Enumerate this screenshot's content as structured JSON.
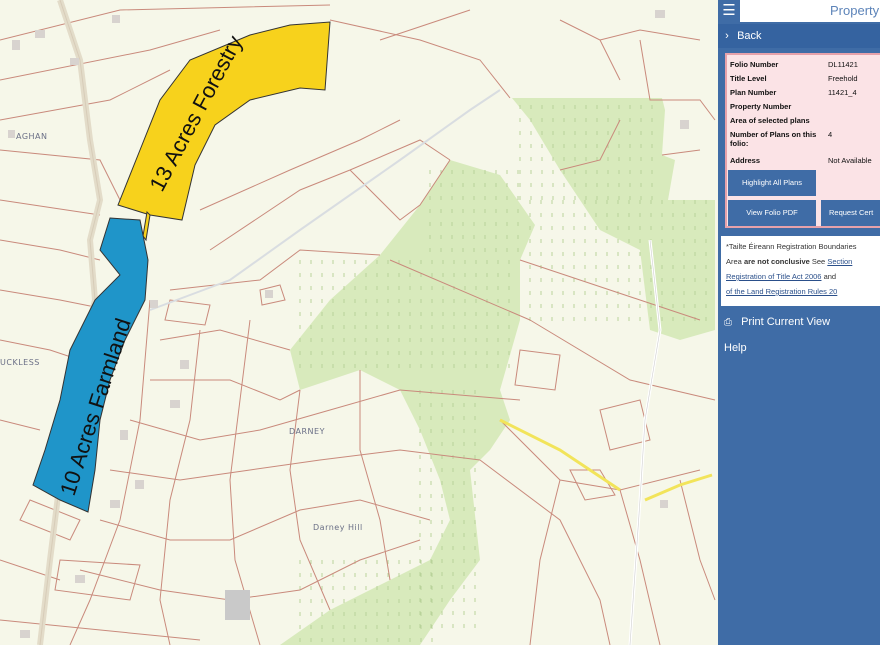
{
  "map": {
    "parcels": [
      {
        "label": "13 Acres Forestry",
        "color": "#f7d21c"
      },
      {
        "label": "10 Acres Farmland",
        "color": "#1f95c9"
      }
    ],
    "places": [
      "AGHAN",
      "UCKLESS",
      "DARNEY",
      "Darney Hill"
    ],
    "colors": {
      "base": "#f6f7e9",
      "forest": "#d8eabc",
      "boundary": "#c98a7c",
      "road": "#f2e45a"
    }
  },
  "panel": {
    "menu_icon": "hamburger-icon",
    "title": "Property",
    "back_label": "Back",
    "info": {
      "rows": [
        {
          "key": "Folio Number",
          "value": "DL11421"
        },
        {
          "key": "Title Level",
          "value": "Freehold"
        },
        {
          "key": "Plan Number",
          "value": "11421_4"
        },
        {
          "key": "Property Number",
          "value": ""
        },
        {
          "key": "Area of selected plans",
          "value": ""
        },
        {
          "key": "Number of Plans on this folio:",
          "value": "4"
        },
        {
          "key": "Address",
          "value": "Not Available"
        }
      ],
      "highlight_button": "Highlight All Plans",
      "pdf_button": "View Folio PDF",
      "request_button": "Request Cert"
    },
    "note": {
      "line1": "*Tailte Éireann Registration Boundaries",
      "line2_pre": "Area ",
      "line2_bold": "are not conclusive",
      "line2_mid": " See ",
      "line2_link": "Section",
      "line3_link": "Registration of Title Act 2006",
      "line3_post": " and",
      "line4_link": "of the Land Registration Rules 20"
    },
    "print_label": "Print Current View",
    "help_label": "Help"
  }
}
